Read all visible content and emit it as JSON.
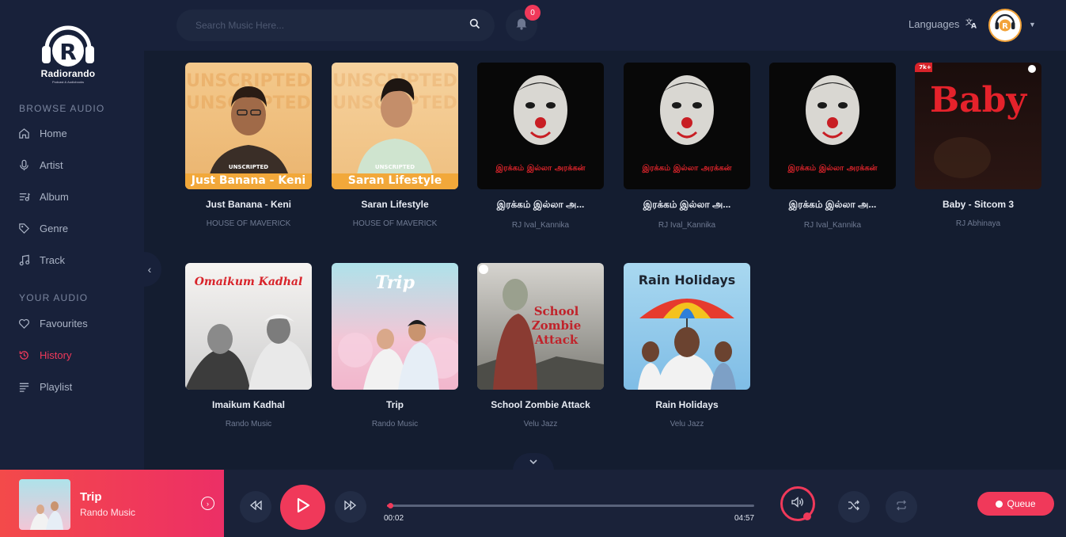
{
  "brand": {
    "name": "Radiorando",
    "tagline": "Podcast & Audiobooks"
  },
  "sidebar": {
    "browse_heading": "BROWSE AUDIO",
    "browse_items": [
      {
        "label": "Home",
        "icon": "home-icon"
      },
      {
        "label": "Artist",
        "icon": "microphone-icon"
      },
      {
        "label": "Album",
        "icon": "album-list-icon"
      },
      {
        "label": "Genre",
        "icon": "tag-icon"
      },
      {
        "label": "Track",
        "icon": "music-note-icon"
      }
    ],
    "your_heading": "YOUR AUDIO",
    "your_items": [
      {
        "label": "Favourites",
        "icon": "heart-icon"
      },
      {
        "label": "History",
        "icon": "history-icon",
        "active": true
      },
      {
        "label": "Playlist",
        "icon": "playlist-icon"
      }
    ]
  },
  "header": {
    "search_placeholder": "Search Music Here...",
    "notification_count": "0",
    "languages_label": "Languages"
  },
  "cards": [
    {
      "title": "Just Banana - Keni",
      "subtitle": "HOUSE OF MAVERICK",
      "art_caption": "Just Banana - Keni",
      "art_badge": "UNSCRIPTED"
    },
    {
      "title": "Saran Lifestyle",
      "subtitle": "HOUSE OF MAVERICK",
      "art_caption": "Saran Lifestyle",
      "art_badge": "UNSCRIPTED"
    },
    {
      "title": "இரக்கம் இல்லா அ...",
      "subtitle": "RJ Ival_Kannika",
      "art_caption": "இரக்கம் இல்லா அரக்கன்"
    },
    {
      "title": "இரக்கம் இல்லா அ...",
      "subtitle": "RJ Ival_Kannika",
      "art_caption": "இரக்கம் இல்லா அரக்கன்"
    },
    {
      "title": "இரக்கம் இல்லா அ...",
      "subtitle": "RJ Ival_Kannika",
      "art_caption": "இரக்கம் இல்லா அரக்கன்"
    },
    {
      "title": "Baby - Sitcom 3",
      "subtitle": "RJ Abhinaya",
      "art_caption": "Baby",
      "art_badge": "7k+"
    },
    {
      "title": "Imaikum Kadhal",
      "subtitle": "Rando Music",
      "art_caption": "Omaikum Kadhal"
    },
    {
      "title": "Trip",
      "subtitle": "Rando Music",
      "art_caption": "Trip"
    },
    {
      "title": "School Zombie Attack",
      "subtitle": "Velu Jazz",
      "art_caption": "School Zombie Attack"
    },
    {
      "title": "Rain Holidays",
      "subtitle": "Velu Jazz",
      "art_caption": "Rain Holidays"
    }
  ],
  "player": {
    "title": "Trip",
    "artist": "Rando Music",
    "elapsed": "00:02",
    "duration": "04:57",
    "progress_fraction": 0.007,
    "queue_label": "Queue"
  },
  "colors": {
    "accent": "#f0395a",
    "background": "#141d30",
    "panel": "#18213a"
  }
}
